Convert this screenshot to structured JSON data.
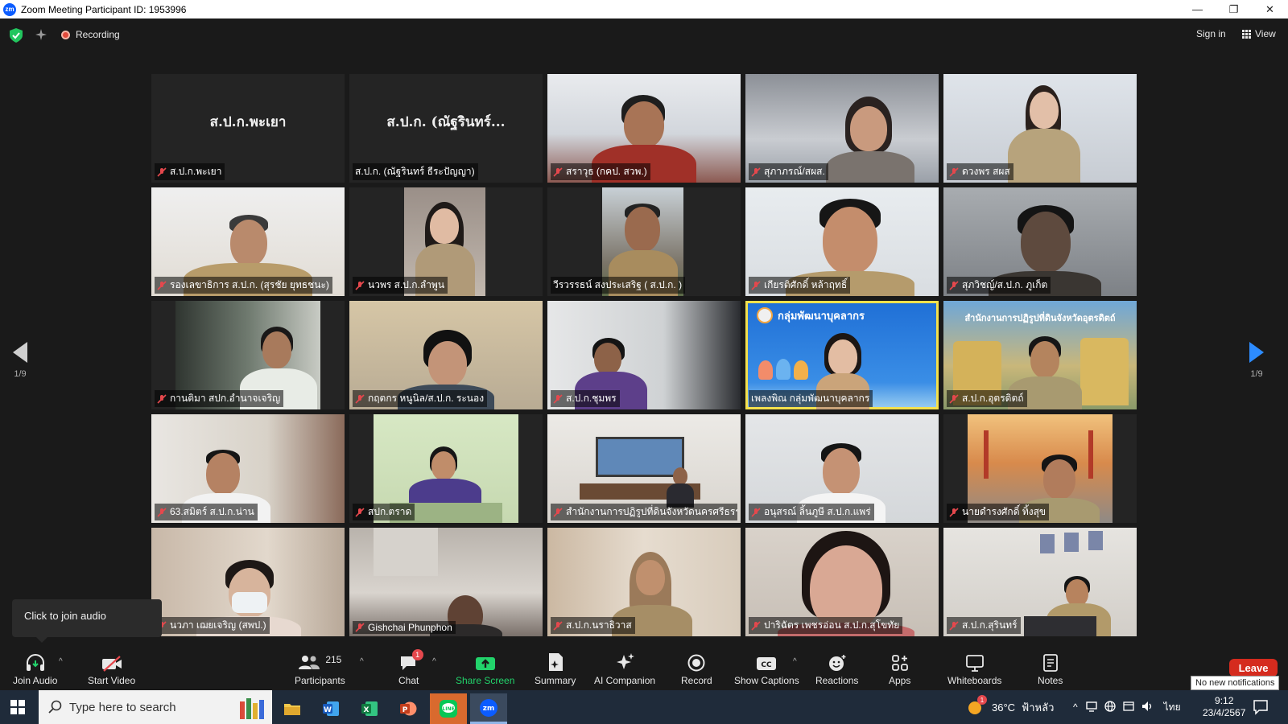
{
  "window": {
    "title": "Zoom Meeting Participant ID: 1953996",
    "logo_text": "zm",
    "controls": [
      "—",
      "❐",
      "✕"
    ]
  },
  "topbar": {
    "recording_label": "Recording",
    "signin_label": "Sign in",
    "view_label": "View"
  },
  "gallery": {
    "page_left": "1/9",
    "page_right": "1/9",
    "tile_names": {
      "t0": "ส.ป.ก.พะเยา",
      "t1": "ส.ป.ก. (ณัฐรินทร์..."
    },
    "labels": [
      "ส.ป.ก.พะเยา",
      "ส.ป.ก. (ณัฐรินทร์ ธีระปัญญา)",
      "สราวุธ (กคป. สวพ.)",
      "สุภาภรณ์/สผส.",
      "ดวงพร สผส",
      "รองเลขาธิการ ส.ป.ก. (สุรชัย ยุทธชนะ)",
      "นวพร ส.ป.ก.ลำพูน",
      "วีรวรรธน์ สงประเสริฐ ( ส.ป.ก. )",
      "เกียรติศักดิ์ หล้าฤทธิ์",
      "สุภวิชญ์/ส.ป.ก. ภูเก็ต",
      "กานติมา สปก.อำนาจเจริญ",
      "กฤตกร หนูนิล/ส.ป.ก. ระนอง",
      "ส.ป.ก.ชุมพร",
      "เพลงพิณ กลุ่มพัฒนาบุคลากร",
      "ส.ป.ก.อุตรดิตถ์",
      "63.สมิตร์ ส.ป.ก.น่าน",
      "สปก.ตราด",
      "สำนักงานการปฏิรูปที่ดินจังหวัดนครศรีธรร...",
      "อนุสรณ์ ลิ้นภูษี ส.ป.ก.แพร่",
      "นายดำรงศักดิ์ ทิ้งสุข",
      "นวภา เฌยเจริญ (สพป.)",
      "Gishchai Phunphon",
      "ส.ป.ก.นราธิวาส",
      "ปาริฉัตร เพชรอ่อน ส.ป.ก.สุโขทัย",
      "ส.ป.ก.สุรินทร์"
    ],
    "banners": {
      "t13": "กลุ่มพัฒนาบุคลากร",
      "t14": "สำนักงานการปฏิรูปที่ดินจังหวัดอุตรดิตถ์"
    }
  },
  "tooltip": {
    "text": "Click to join audio"
  },
  "toolbar": {
    "join_audio": "Join Audio",
    "start_video": "Start Video",
    "participants": "Participants",
    "participants_count": "215",
    "chat": "Chat",
    "chat_badge": "1",
    "share_screen": "Share Screen",
    "summary": "Summary",
    "ai_companion": "AI Companion",
    "record": "Record",
    "show_captions": "Show Captions",
    "reactions": "Reactions",
    "apps": "Apps",
    "whiteboards": "Whiteboards",
    "notes": "Notes",
    "leave": "Leave",
    "notifications": "No new notifications"
  },
  "taskbar": {
    "search_placeholder": "Type here to search",
    "weather_temp": "36°C",
    "weather_text": "ฟ้าหลัว",
    "lang": "ไทย",
    "time": "9:12",
    "date": "23/4/2567",
    "weather_badge": "1"
  },
  "colors": {
    "accent_blue": "#0b5cff",
    "share_green": "#22d36b",
    "leave_red": "#d52b1e",
    "active_speaker": "#f4e14d"
  }
}
